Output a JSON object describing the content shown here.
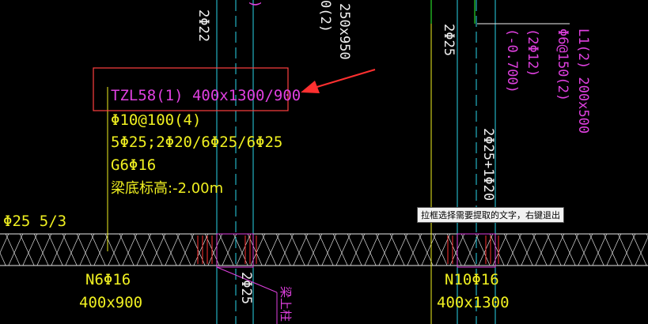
{
  "colors": {
    "background": "#000000",
    "cyan": "#2ad4e8",
    "magenta": "#e040e0",
    "yellow": "#f0f020",
    "white": "#f0f0f0",
    "red": "#ff3030",
    "green": "#30ff30",
    "highlight_box": "#ff4040"
  },
  "icons": {
    "arrow": "annotation-arrow-icon"
  },
  "labels": {
    "top_2phi22": "2Φ22",
    "top_paren": ")",
    "top_250x950": "250x950",
    "top_0_2": "0(2)",
    "mid_2phi25": "2Φ25",
    "minus_0700": "(-0.700)",
    "two_phi12": "(2Φ12)",
    "phi6_150": "Φ6@150(2)",
    "l1_200x500": "L1(2) 200x500",
    "right_2phi25_1phi20": "2Φ25+1Φ20",
    "beam_tzl58": "TZL58(1) 400x1300/900",
    "beam_stirrup": "Φ10@100(4)",
    "beam_main": "5Φ25;2Φ20/6Φ25/6Φ25",
    "beam_g": "G6Φ16",
    "beam_bottom": "梁底标高:-2.00m",
    "left_phi25": "Φ25 5/3",
    "bottom_n6": "N6Φ16",
    "bottom_400x900": "400x900",
    "bottom_2phi25": "2Φ25",
    "bottom_beam_top": "梁上柱",
    "bottom_n10": "N10Φ16",
    "bottom_400x1300": "400x1300"
  },
  "tooltip": "拉框选择需要提取的文字，右键退出"
}
